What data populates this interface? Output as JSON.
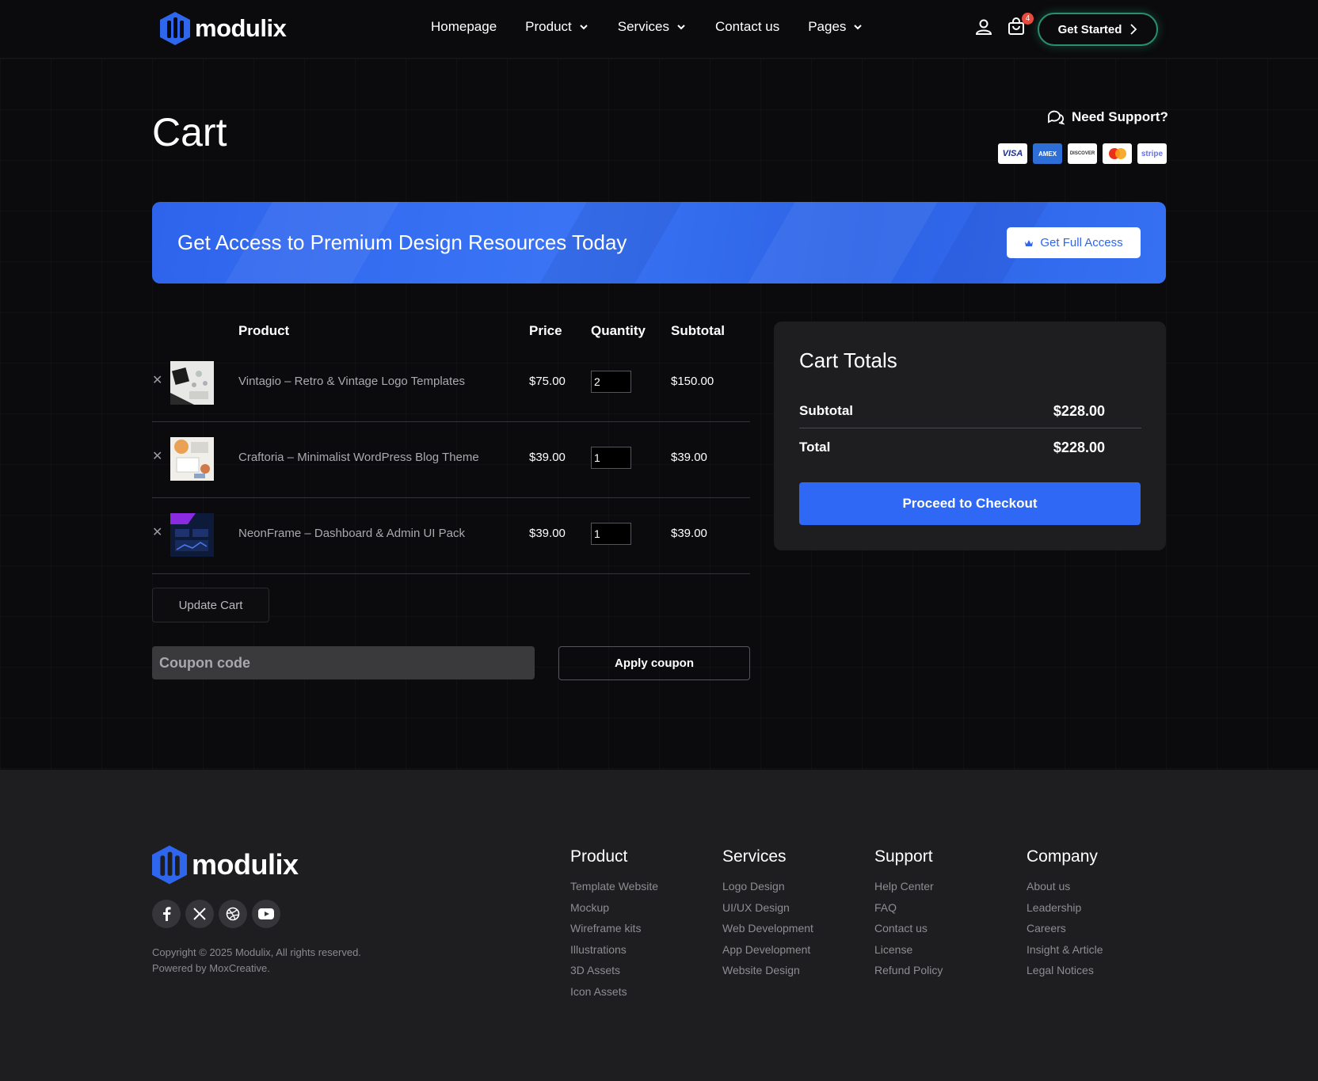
{
  "header": {
    "brand": "modulix",
    "nav": [
      {
        "label": "Homepage",
        "has_dropdown": false
      },
      {
        "label": "Product",
        "has_dropdown": true
      },
      {
        "label": "Services",
        "has_dropdown": true
      },
      {
        "label": "Contact us",
        "has_dropdown": false
      },
      {
        "label": "Pages",
        "has_dropdown": true
      }
    ],
    "cart_count": "4",
    "cta_label": "Get Started"
  },
  "page": {
    "title": "Cart",
    "support_label": "Need Support?",
    "payment_methods": [
      "VISA",
      "AMEX",
      "DISCOVER",
      "mastercard",
      "stripe"
    ]
  },
  "banner": {
    "title": "Get Access to Premium Design Resources Today",
    "button_label": "Get Full Access",
    "color": "#2f66ee"
  },
  "cart": {
    "columns": {
      "product": "Product",
      "price": "Price",
      "quantity": "Quantity",
      "subtotal": "Subtotal"
    },
    "items": [
      {
        "name": "Vintagio – Retro & Vintage Logo Templates",
        "price": "$75.00",
        "quantity": "2",
        "subtotal": "$150.00"
      },
      {
        "name": "Craftoria – Minimalist WordPress Blog Theme",
        "price": "$39.00",
        "quantity": "1",
        "subtotal": "$39.00"
      },
      {
        "name": "NeonFrame – Dashboard & Admin UI Pack",
        "price": "$39.00",
        "quantity": "1",
        "subtotal": "$39.00"
      }
    ],
    "update_label": "Update Cart",
    "coupon_placeholder": "Coupon code",
    "apply_label": "Apply coupon"
  },
  "totals": {
    "title": "Cart Totals",
    "subtotal_label": "Subtotal",
    "subtotal_value": "$228.00",
    "total_label": "Total",
    "total_value": "$228.00",
    "checkout_label": "Proceed to Checkout",
    "accent": "#2f68f5"
  },
  "footer": {
    "brand": "modulix",
    "socials": [
      "facebook-icon",
      "x-icon",
      "dribbble-icon",
      "youtube-icon"
    ],
    "copyright_line1": "Copyright © 2025 Modulix, All rights reserved.",
    "copyright_line2": "Powered by MoxCreative.",
    "columns": [
      {
        "title": "Product",
        "links": [
          "Template Website",
          "Mockup",
          "Wireframe kits",
          "Illustrations",
          "3D Assets",
          "Icon Assets"
        ]
      },
      {
        "title": "Services",
        "links": [
          "Logo Design",
          "UI/UX Design",
          "Web Development",
          "App Development",
          "Website Design"
        ]
      },
      {
        "title": "Support",
        "links": [
          "Help Center",
          "FAQ",
          "Contact us",
          "License",
          "Refund Policy"
        ]
      },
      {
        "title": "Company",
        "links": [
          "About us",
          "Leadership",
          "Careers",
          "Insight & Article",
          "Legal Notices"
        ]
      }
    ]
  }
}
